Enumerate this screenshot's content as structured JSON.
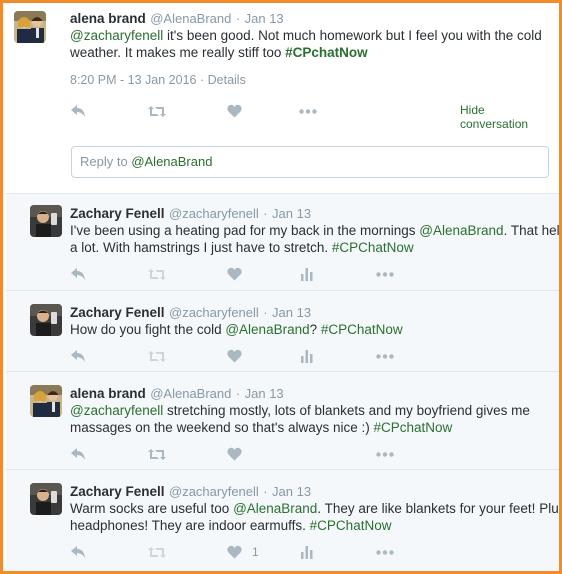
{
  "main_tweet": {
    "author_name": "alena brand",
    "author_handle": "@AlenaBrand",
    "date": "Jan 13",
    "text_parts": {
      "mention": "@zacharyfenell",
      "body1": " it's been good. Not much homework but I feel you with the cold",
      "body2": "weather. It makes me really stiff too ",
      "hashtag": "#CPchatNow"
    },
    "timestamp": "8:20 PM - 13 Jan 2016",
    "details_label": "Details",
    "hide_conversation": "Hide conversation",
    "reply_placeholder": "Reply to ",
    "reply_mention": "@AlenaBrand"
  },
  "replies": [
    {
      "author_name": "Zachary Fenell",
      "author_handle": "@zacharyfenell",
      "date": "Jan 13",
      "line1_pre": "I've been using a heating pad for my back in the mornings ",
      "line1_mention": "@AlenaBrand",
      "line1_post": ". That helps",
      "line2_pre": "a lot. With hamstrings I just have to stretch. ",
      "line2_hashtag": "#CPChatNow"
    },
    {
      "author_name": "Zachary Fenell",
      "author_handle": "@zacharyfenell",
      "date": "Jan 13",
      "line1_pre": "How do you fight the cold ",
      "line1_mention": "@AlenaBrand",
      "line1_post": "? ",
      "line1_hashtag": "#CPChatNow"
    },
    {
      "author_name": "alena brand",
      "author_handle": "@AlenaBrand",
      "date": "Jan 13",
      "line1_mention": "@zacharyfenell",
      "line1_post": " stretching mostly, lots of blankets and my boyfriend gives me",
      "line2_pre": "massages on the weekend so that's always nice :) ",
      "line2_hashtag": "#CPchatNow"
    },
    {
      "author_name": "Zachary Fenell",
      "author_handle": "@zacharyfenell",
      "date": "Jan 13",
      "line1_pre": "Warm socks are useful too ",
      "line1_mention": "@AlenaBrand",
      "line1_post": ". They are like blankets for your feet! Plus",
      "line2_pre": "headphones! They are indoor earmuffs. ",
      "line2_hashtag": "#CPChatNow",
      "like_count": "1"
    }
  ],
  "separator_dot": "·",
  "icons": [
    "reply-icon",
    "retweet-icon",
    "heart-icon",
    "analytics-icon",
    "more-icon"
  ],
  "colors": {
    "frame": "#f28c2a",
    "link": "#2b6f31",
    "muted": "#8899a6",
    "icon": "#aab8c2"
  }
}
